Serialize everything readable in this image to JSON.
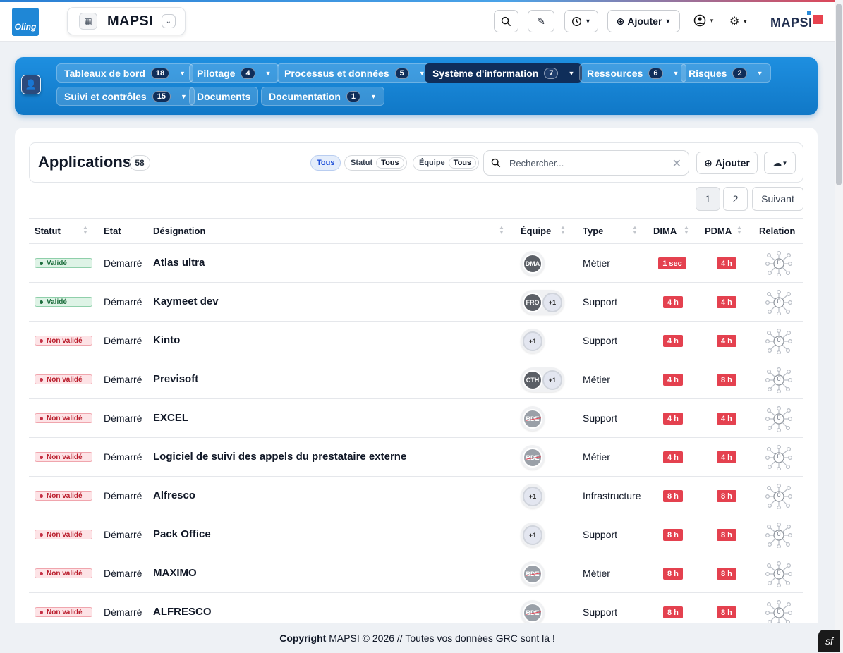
{
  "app": {
    "logo_text": "Oling",
    "name": "MAPSI",
    "brand_text": "MAPSI"
  },
  "toolbar": {
    "add_label": "Ajouter"
  },
  "nav": {
    "items": [
      {
        "label": "Tableaux de bord",
        "count": "18"
      },
      {
        "label": "Pilotage",
        "count": "4"
      },
      {
        "label": "Processus et données",
        "count": "5"
      },
      {
        "label": "Système d'information",
        "count": "7"
      },
      {
        "label": "Ressources",
        "count": "6"
      },
      {
        "label": "Risques",
        "count": "2"
      },
      {
        "label": "Suivi et contrôles",
        "count": "15"
      },
      {
        "label": "Documents"
      },
      {
        "label": "Documentation",
        "count": "1"
      }
    ]
  },
  "header": {
    "title": "Applications",
    "count": "58",
    "filter_all": "Tous",
    "filter_status_label": "Statut",
    "filter_status_value": "Tous",
    "filter_team_label": "Équipe",
    "filter_team_value": "Tous",
    "search_placeholder": "Rechercher...",
    "add_label": "Ajouter"
  },
  "pagination": {
    "pages": [
      "1",
      "2"
    ],
    "next": "Suivant"
  },
  "table": {
    "columns": [
      "Statut",
      "Etat",
      "Désignation",
      "Équipe",
      "Type",
      "DIMA",
      "PDMA",
      "Relation"
    ],
    "rows": [
      {
        "status": "Validé",
        "etat": "Démarré",
        "name": "Atlas ultra",
        "team": [
          "DMA"
        ],
        "type": "Métier",
        "dima": "1 sec",
        "pdma": "4 h",
        "relations": "0"
      },
      {
        "status": "Validé",
        "etat": "Démarré",
        "name": "Kaymeet dev",
        "team": [
          "FRO",
          "+1"
        ],
        "type": "Support",
        "dima": "4 h",
        "pdma": "4 h",
        "relations": "0"
      },
      {
        "status": "Non validé",
        "etat": "Démarré",
        "name": "Kinto",
        "team": [
          "+1"
        ],
        "type": "Support",
        "dima": "4 h",
        "pdma": "4 h",
        "relations": "0"
      },
      {
        "status": "Non validé",
        "etat": "Démarré",
        "name": "Previsoft",
        "team": [
          "CTH",
          "+1"
        ],
        "type": "Métier",
        "dima": "4 h",
        "pdma": "8 h",
        "relations": "0"
      },
      {
        "status": "Non validé",
        "etat": "Démarré",
        "name": "EXCEL",
        "team": [
          "BDE"
        ],
        "type": "Support",
        "dima": "4 h",
        "pdma": "4 h",
        "relations": "0"
      },
      {
        "status": "Non validé",
        "etat": "Démarré",
        "name": "Logiciel de suivi des appels du prestataire externe",
        "team": [
          "BDE"
        ],
        "type": "Métier",
        "dima": "4 h",
        "pdma": "4 h",
        "relations": "0"
      },
      {
        "status": "Non validé",
        "etat": "Démarré",
        "name": "Alfresco",
        "team": [
          "+1"
        ],
        "type": "Infrastructure",
        "dima": "8 h",
        "pdma": "8 h",
        "relations": "0"
      },
      {
        "status": "Non validé",
        "etat": "Démarré",
        "name": "Pack Office",
        "team": [
          "+1"
        ],
        "type": "Support",
        "dima": "8 h",
        "pdma": "8 h",
        "relations": "0"
      },
      {
        "status": "Non validé",
        "etat": "Démarré",
        "name": "MAXIMO",
        "team": [
          "BDE"
        ],
        "type": "Métier",
        "dima": "8 h",
        "pdma": "8 h",
        "relations": "0"
      },
      {
        "status": "Non validé",
        "etat": "Démarré",
        "name": "ALFRESCO",
        "team": [
          "BDE"
        ],
        "type": "Support",
        "dima": "8 h",
        "pdma": "8 h",
        "relations": "0"
      }
    ]
  },
  "footer": {
    "bold": "Copyright",
    "text": "MAPSI © 2026 // Toutes vos données GRC sont là !"
  },
  "colors": {
    "accent": "#1e8fe0",
    "nav_active": "#0f2e5a",
    "danger": "#e4414f",
    "success": "#1d6e3d"
  }
}
